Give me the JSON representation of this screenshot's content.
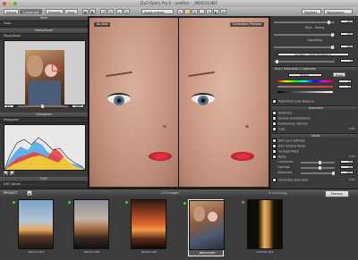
{
  "window": {
    "title": "DxO Optics Pro 6 – untitled – _MB4516.NEF"
  },
  "toolbar": {
    "tabs": [
      "Select",
      "Customize",
      "Process",
      "View"
    ],
    "preset_label": "Apply preset",
    "palettes_label": "Palettes",
    "workspace_label": "Workspace"
  },
  "left_panel": {
    "tools_header": "Tools",
    "tools_sub": "Tools",
    "move_zoom_header": "Move/Zoom",
    "move_zoom_sub": "Move/Zoom",
    "zoom_value": "1:1",
    "zoom_percent": "100%",
    "histogram_header": "Histogram",
    "histogram_sub": "Histogram",
    "exif_header": "EXIF",
    "exif_sub": "EXIF Values",
    "exif_camera": "Camera: Nikon D300"
  },
  "viewer": {
    "before_label": "As shot",
    "after_label": "Correction Preview"
  },
  "right_panel": {
    "rows": [
      "Style - Toning",
      "Vignetting",
      "As Shot — Dark Filmback 2",
      "Hue / Saturation / Lightness",
      "Master",
      "Multi-Point Color Balance",
      "Geometry",
      "Distortion",
      "Volume Anamorphosis",
      "Keystoning / Horizon",
      "Crop",
      "Detail",
      "DxO Lens Softness",
      "DxO Chroma Noise",
      "Unsharp Mask",
      "Noise",
      "Luminance",
      "Contrast",
      "Sharpness",
      "Chromatic aberration"
    ],
    "values": [
      "100",
      "100",
      "100",
      "0",
      "0",
      "0",
      "55",
      "55",
      "100"
    ],
    "auto_label": "Auto",
    "reset_label": "Reset"
  },
  "project_bar": {
    "label": "PROJECT",
    "count": "115 images",
    "process_label": "Process",
    "view_label": "To main stage"
  },
  "filmstrip": {
    "items": [
      {
        "caption": "_MB4419.NEF"
      },
      {
        "caption": "_MB4437.NEF"
      },
      {
        "caption": "_MB4442.NEF"
      },
      {
        "caption": "_MB4516.NEF"
      },
      {
        "caption": "IMG0025.NEF"
      }
    ]
  },
  "colors": {
    "accent": "#5fbf3f",
    "lip": "#d62b39",
    "iris": "#4b6d84"
  }
}
